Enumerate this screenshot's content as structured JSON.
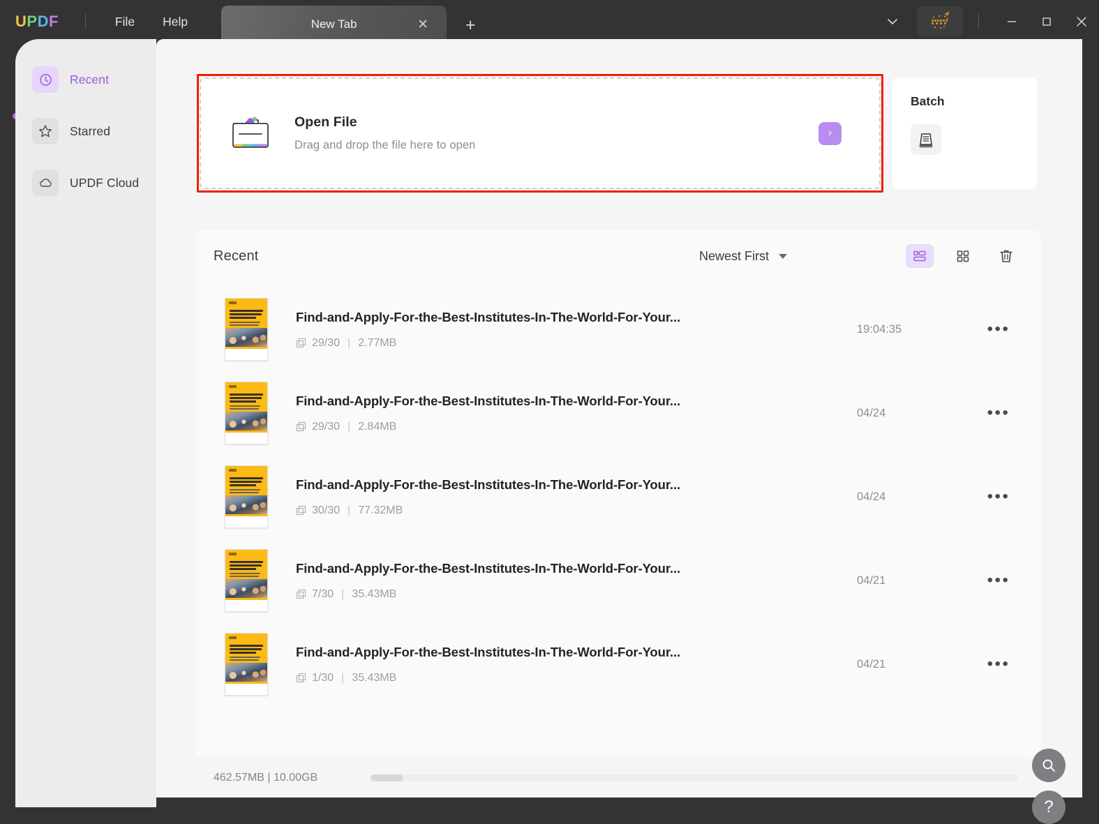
{
  "titlebar": {
    "logo_parts": [
      "U",
      "P",
      "D",
      "F"
    ],
    "menus": [
      {
        "label": "File",
        "name": "menu-file"
      },
      {
        "label": "Help",
        "name": "menu-help"
      }
    ],
    "tab": {
      "label": "New Tab",
      "close": "✕"
    },
    "new_tab": "+",
    "ai_badge_name": "ai-sparkle-badge",
    "window_controls": {
      "minimize": "minimize",
      "maximize": "maximize",
      "close": "close"
    },
    "colors": {
      "logo_u": "#F5C242",
      "logo_p": "#6FCF7B",
      "logo_d": "#56B9E8",
      "logo_f": "#C07BE8",
      "bar_bg": "#333334"
    }
  },
  "sidebar": {
    "items": [
      {
        "label": "Recent",
        "icon": "clock-icon",
        "active": true
      },
      {
        "label": "Starred",
        "icon": "star-icon",
        "active": false
      },
      {
        "label": "UPDF Cloud",
        "icon": "cloud-icon",
        "active": false
      }
    ],
    "active_color": "#9a5bd8"
  },
  "open_file_card": {
    "title": "Open File",
    "subtitle": "Drag and drop the file here to open",
    "arrow": "›",
    "highlight_color": "#f02000",
    "arrow_bg": "#b98cf0"
  },
  "batch_panel": {
    "title": "Batch",
    "icon": "batch-stack-icon"
  },
  "recent": {
    "title": "Recent",
    "sort_label": "Newest First",
    "views": [
      {
        "name": "list-view",
        "active": true
      },
      {
        "name": "grid-view",
        "active": false
      }
    ],
    "delete_label": "trash-icon",
    "files": [
      {
        "name": "Find-and-Apply-For-the-Best-Institutes-In-The-World-For-Your...",
        "pages": "29/30",
        "size": "2.77MB",
        "time": "19:04:35"
      },
      {
        "name": "Find-and-Apply-For-the-Best-Institutes-In-The-World-For-Your...",
        "pages": "29/30",
        "size": "2.84MB",
        "time": "04/24"
      },
      {
        "name": "Find-and-Apply-For-the-Best-Institutes-In-The-World-For-Your...",
        "pages": "30/30",
        "size": "77.32MB",
        "time": "04/24"
      },
      {
        "name": "Find-and-Apply-For-the-Best-Institutes-In-The-World-For-Your...",
        "pages": "7/30",
        "size": "35.43MB",
        "time": "04/21"
      },
      {
        "name": "Find-and-Apply-For-the-Best-Institutes-In-The-World-For-Your...",
        "pages": "1/30",
        "size": "35.43MB",
        "time": "04/21"
      }
    ],
    "row_menu": "•••"
  },
  "status": {
    "storage_text": "462.57MB | 10.00GB",
    "progress_percent": 5
  },
  "floating": {
    "search": "search-icon",
    "help": "?"
  }
}
